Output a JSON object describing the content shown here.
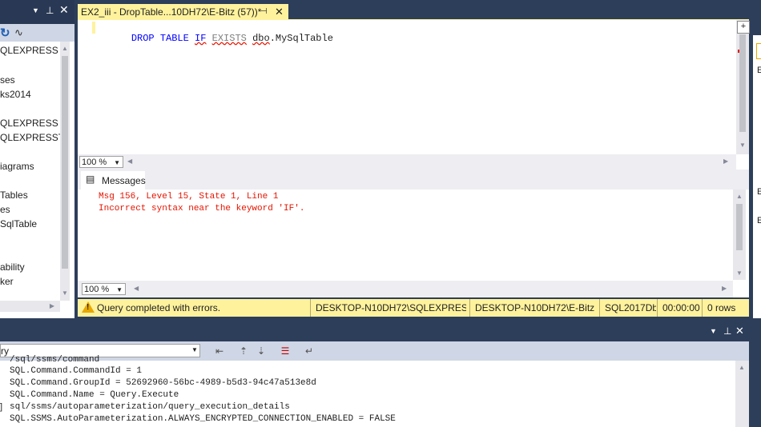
{
  "explorer": {
    "tree_items": [
      "QLEXPRESS (S",
      "ses",
      "ks2014",
      "QLEXPRESS",
      "QLEXPRESSTe",
      "iagrams",
      "Tables",
      "es",
      "SqlTable",
      "ability",
      "ker"
    ]
  },
  "editor": {
    "tab_title": "EX2_iii - DropTable...10DH72\\E-Bitz (57))*",
    "code": {
      "kw1": "DROP",
      "kw2": "TABLE",
      "kw3": "IF",
      "kw4": "EXISTS",
      "obj1": "dbo",
      "obj2": ".MySqlTable"
    },
    "zoom": "100 %"
  },
  "messages": {
    "tab_label": "Messages",
    "lines": [
      "Msg 156, Level 15, State 1, Line 1",
      "Incorrect syntax near the keyword 'IF'."
    ],
    "zoom": "100 %"
  },
  "status": {
    "message": "Query completed with errors.",
    "server": "DESKTOP-N10DH72\\SQLEXPRESS ...",
    "user": "DESKTOP-N10DH72\\E-Bitz...",
    "database": "SQL2017Db",
    "elapsed": "00:00:00",
    "rows": "0 rows"
  },
  "output": {
    "dropdown_value": "ry",
    "lines": [
      "/sql/ssms/command",
      "SQL.Command.CommandId = 1",
      "SQL.Command.GroupId = 52692960-56bc-4989-b5d3-94c47a513e8d",
      "SQL.Command.Name = Query.Execute",
      "sql/ssms/autoparameterization/query_execution_details",
      "SQL.SSMS.AutoParameterization.ALWAYS_ENCRYPTED_CONNECTION_ENABLED = FALSE"
    ]
  },
  "right_panel": {
    "labels": [
      "E",
      "E",
      "E"
    ]
  },
  "colors": {
    "chrome": "#2d3e5a",
    "tab_active": "#fff29d",
    "error_text": "#e51400",
    "keyword": "#0000ff"
  }
}
